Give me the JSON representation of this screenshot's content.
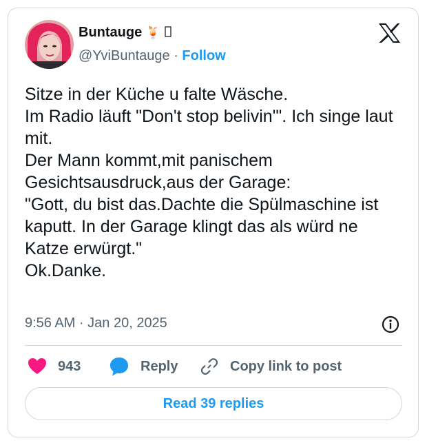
{
  "author": {
    "name": "Buntauge",
    "emoji": "🍹",
    "handle": "@YviBuntauge",
    "separator": "·",
    "follow_label": "Follow"
  },
  "tweet": {
    "text": "Sitze in der Küche u falte Wäsche.\nIm Radio läuft \"Don't stop belivin'\". Ich singe laut mit.\nDer Mann kommt,mit panischem Gesichtsausdruck,aus der Garage:\n\"Gott, du bist das.Dachte die Spülmaschine ist kaputt. In der Garage klingt das als würd ne Katze erwürgt.\"\nOk.Danke.",
    "timestamp": "9:56 AM · Jan 20, 2025"
  },
  "actions": {
    "likes_count": "943",
    "reply_label": "Reply",
    "copy_link_label": "Copy link to post"
  },
  "read_replies_label": "Read 39 replies",
  "icons": {
    "platform": "x-logo-icon",
    "info": "info-icon",
    "like": "heart-icon",
    "reply": "speech-bubble-icon",
    "copy": "link-icon"
  },
  "colors": {
    "accent": "#1d9bf0",
    "like": "#f91880",
    "text_primary": "#0f1419",
    "text_secondary": "#536471",
    "border": "#cfd9de"
  }
}
